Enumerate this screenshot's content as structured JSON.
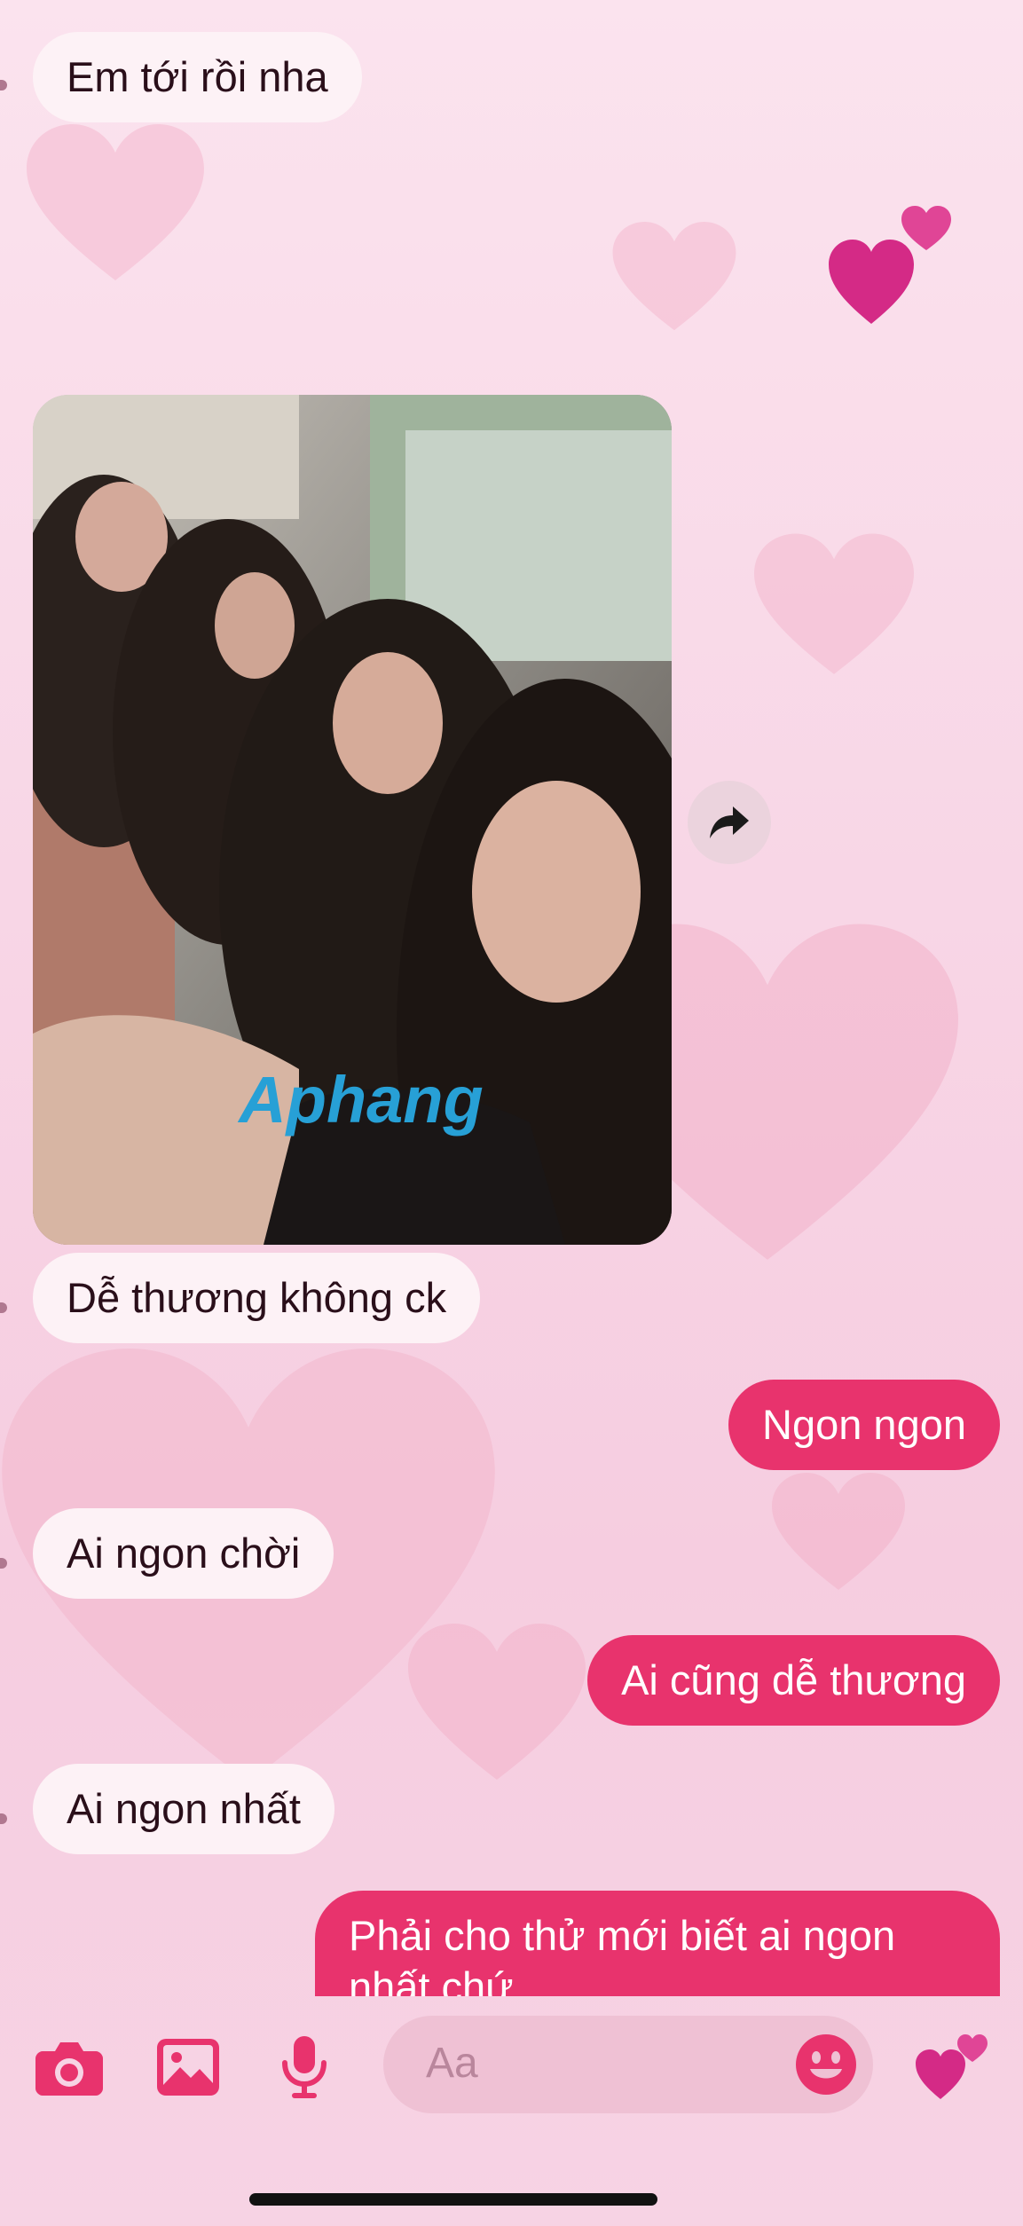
{
  "messages": [
    {
      "side": "in",
      "text": "Em tới rồi nha"
    },
    {
      "side": "in",
      "type": "photo",
      "watermark": "Aphang"
    },
    {
      "side": "in",
      "text": "Dễ thương không ck"
    },
    {
      "side": "out",
      "text": "Ngon ngon"
    },
    {
      "side": "in",
      "text": "Ai ngon chời"
    },
    {
      "side": "out",
      "text": "Ai cũng dễ thương"
    },
    {
      "side": "in",
      "text": "Ai ngon nhất"
    },
    {
      "side": "out",
      "text": "Phải cho thử mới biết ai ngon nhất chứ"
    }
  ],
  "composer": {
    "placeholder": "Aa"
  },
  "icons": {
    "camera": "camera-icon",
    "gallery": "image-icon",
    "mic": "microphone-icon",
    "emoji": "smiley-icon",
    "quick_reaction": "two-hearts-icon",
    "share": "share-arrow-icon"
  },
  "colors": {
    "accent": "#e8336d",
    "incoming_bubble": "#fdf2f6",
    "background": "#f8d6e6"
  }
}
